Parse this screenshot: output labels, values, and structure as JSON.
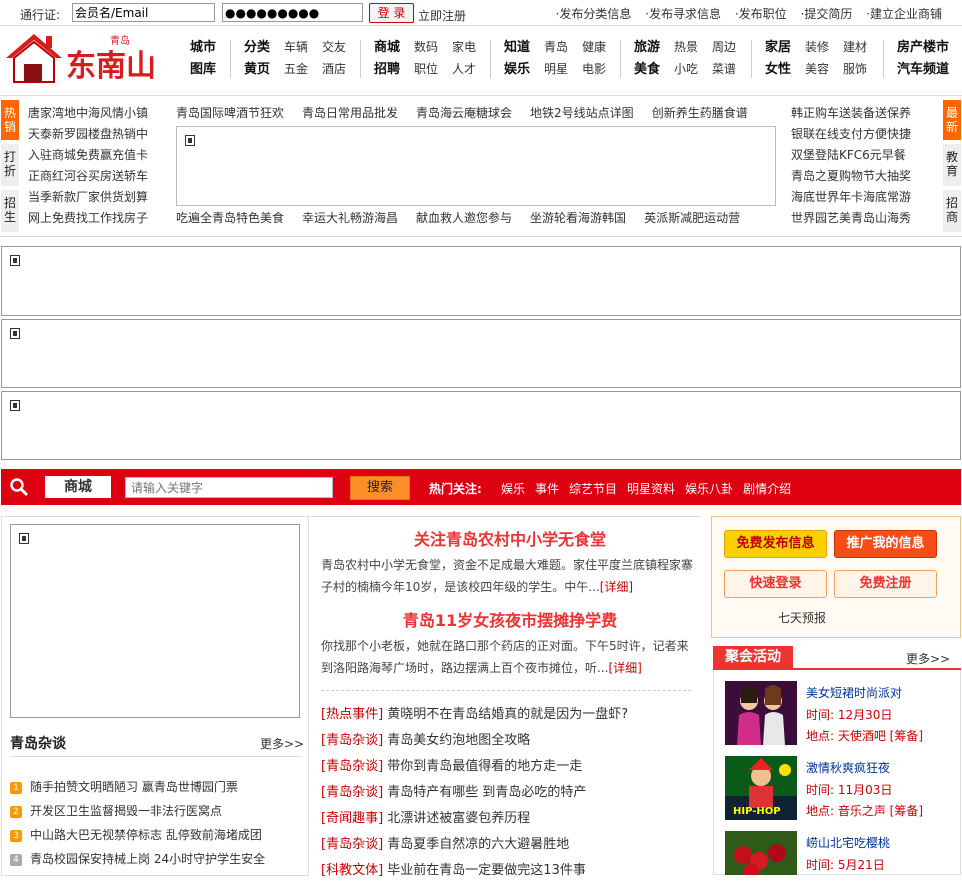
{
  "topbar": {
    "passport_label": "通行证:",
    "username_value": "会员名/Email",
    "password_value": "●●●●●●●●●",
    "login_label": "登 录",
    "register_label": "立即注册",
    "links": [
      "·发布分类信息",
      "·发布寻求信息",
      "·发布职位",
      "·提交简历",
      "·建立企业商铺"
    ]
  },
  "logo": {
    "text": "东南山",
    "small": "青岛"
  },
  "nav": [
    {
      "row1": [
        "城市"
      ],
      "row2": [
        "图库"
      ]
    },
    {
      "row1": [
        "分类",
        "车辆",
        "交友"
      ],
      "row2": [
        "黄页",
        "五金",
        "酒店"
      ]
    },
    {
      "row1": [
        "商城",
        "数码",
        "家电"
      ],
      "row2": [
        "招聘",
        "职位",
        "人才"
      ]
    },
    {
      "row1": [
        "知道",
        "青岛",
        "健康"
      ],
      "row2": [
        "娱乐",
        "明星",
        "电影"
      ]
    },
    {
      "row1": [
        "旅游",
        "热景",
        "周边"
      ],
      "row2": [
        "美食",
        "小吃",
        "菜谱"
      ]
    },
    {
      "row1": [
        "家居",
        "装修",
        "建材"
      ],
      "row2": [
        "女性",
        "美容",
        "服饰"
      ]
    },
    {
      "row1": [
        "房产楼市"
      ],
      "row2": [
        "汽车频道"
      ]
    }
  ],
  "hot": {
    "left_tabs": [
      "热销",
      "打折",
      "招生"
    ],
    "right_tabs": [
      "最新",
      "教育",
      "招商"
    ],
    "col1": [
      "唐家湾地中海风情小镇",
      "天泰新罗园楼盘热销中",
      "入驻商城免费赢充值卡",
      "正商红河谷买房送轿车",
      "当季新款厂家供货划算",
      "网上免费找工作找房子"
    ],
    "row1": [
      "青岛国际啤酒节狂欢",
      "青岛日常用品批发",
      "青岛海云庵糖球会",
      "地铁2号线站点详图",
      "创新养生药膳食谱"
    ],
    "row2": [
      "吃遍全青岛特色美食",
      "幸运大礼畅游海昌",
      "献血救人邀您参与",
      "坐游轮看海游韩国",
      "英派斯减肥运动营"
    ],
    "col3": [
      "韩正购车送装备送保养",
      "银联在线支付方便快捷",
      "双堡登陆KFC6元早餐",
      "青岛之夏购物节大抽奖",
      "海底世界年卡海底常游",
      "世界园艺美青岛山海秀"
    ]
  },
  "search": {
    "category": "商城",
    "placeholder": "请输入关键字",
    "button": "搜索",
    "hot_label": "热门关注:",
    "hot_links": [
      "娱乐",
      "事件",
      "综艺节目",
      "明星资料",
      "娱乐八卦",
      "剧情介绍"
    ]
  },
  "zatan": {
    "title": "青岛杂谈",
    "more": "更多>>",
    "items": [
      {
        "n": "1",
        "text": "随手拍赞文明晒陋习 赢青岛世博园门票",
        "color": "#f90"
      },
      {
        "n": "2",
        "text": "开发区卫生监督揭毁一非法行医窝点",
        "color": "#f90"
      },
      {
        "n": "3",
        "text": "中山路大巴无视禁停标志 乱停致前海堵成团",
        "color": "#f90"
      },
      {
        "n": "4",
        "text": "青岛校园保安持械上岗 24小时守护学生安全",
        "color": "#aaa"
      }
    ]
  },
  "middle": {
    "headline1": "关注青岛农村中小学无食堂",
    "summary1": "青岛农村中小学无食堂，资金不足成最大难题。家住平度兰底镇程家寨子村的楠楠今年10岁，是该校四年级的学生。中午...",
    "detail": "[详细]",
    "headline2": "青岛11岁女孩夜市摆摊挣学费",
    "summary2": "你找那个小老板，她就在路口那个药店的正对面。下午5时许，记者来到洛阳路海琴广场时，路边摆满上百个夜市摊位，听...",
    "news": [
      {
        "tag": "[热点事件]",
        "title": "黄晓明不在青岛结婚真的就是因为一盘虾?"
      },
      {
        "tag": "[青岛杂谈]",
        "title": "青岛美女约泡地图全攻略"
      },
      {
        "tag": "[青岛杂谈]",
        "title": "带你到青岛最值得看的地方走一走"
      },
      {
        "tag": "[青岛杂谈]",
        "title": "青岛特产有哪些 到青岛必吃的特产"
      },
      {
        "tag": "[奇闻趣事]",
        "title": "北漂讲述被富婆包养历程"
      },
      {
        "tag": "[青岛杂谈]",
        "title": "青岛夏季自然凉的六大避暑胜地"
      },
      {
        "tag": "[科教文体]",
        "title": "毕业前在青岛一定要做完这13件事"
      }
    ]
  },
  "right": {
    "btn_publish": "免费发布信息",
    "btn_promote": "推广我的信息",
    "btn_login": "快速登录",
    "btn_register": "免费注册",
    "forecast": "七天预报",
    "events_title": "聚会活动",
    "events_more": "更多>>",
    "events": [
      {
        "title": "美女短裙时尚派对",
        "time": "时间: 12月30日",
        "place": "地点: 天使酒吧 [筹备]"
      },
      {
        "title": "激情秋爽疯狂夜",
        "time": "时间: 11月03日",
        "place": "地点: 音乐之声 [筹备]"
      },
      {
        "title": "崂山北宅吃樱桃",
        "time": "时间: 5月21日",
        "place": ""
      }
    ]
  }
}
